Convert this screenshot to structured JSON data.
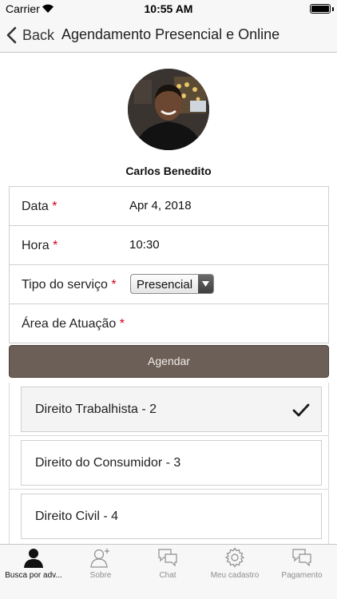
{
  "status": {
    "carrier": "Carrier",
    "time": "10:55 AM"
  },
  "nav": {
    "back_label": "Back",
    "title": "Agendamento Presencial e Online"
  },
  "profile": {
    "name": "Carlos Benedito"
  },
  "form": {
    "data_label": "Data",
    "data_value": "Apr 4, 2018",
    "hora_label": "Hora",
    "hora_value": "10:30",
    "tipo_label": "Tipo do serviço",
    "tipo_value": "Presencial",
    "area_label": "Área de Atuação",
    "required_mark": "*"
  },
  "agendar_label": "Agendar",
  "areas": [
    {
      "label": "Direito Trabalhista - 2",
      "selected": true
    },
    {
      "label": "Direito do Consumidor - 3",
      "selected": false
    },
    {
      "label": "Direito Civil - 4",
      "selected": false
    }
  ],
  "tabs": [
    {
      "label": "Busca por adv...",
      "icon": "person-icon",
      "active": true
    },
    {
      "label": "Sobre",
      "icon": "person-add-icon",
      "active": false
    },
    {
      "label": "Chat",
      "icon": "chat-icon",
      "active": false
    },
    {
      "label": "Meu cadastro",
      "icon": "gear-icon",
      "active": false
    },
    {
      "label": "Pagamento",
      "icon": "payment-chat-icon",
      "active": false
    }
  ],
  "colors": {
    "accent_button": "#6c5f57",
    "required": "#d0021b"
  }
}
